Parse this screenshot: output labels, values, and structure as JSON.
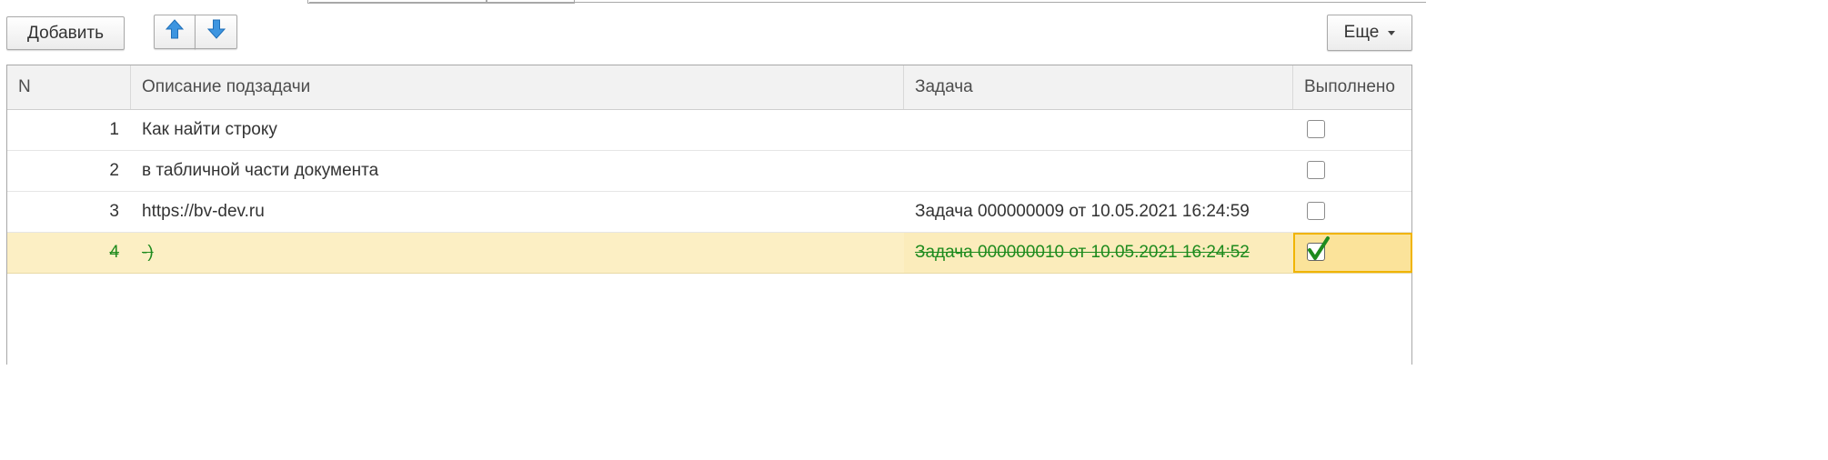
{
  "toolbar": {
    "add_label": "Добавить",
    "more_label": "Еще"
  },
  "table": {
    "columns": [
      "N",
      "Описание подзадачи",
      "Задача",
      "Выполнено"
    ],
    "rows": [
      {
        "n": "1",
        "description": "Как найти строку",
        "task": "",
        "done": false
      },
      {
        "n": "2",
        "description": "в табличной части документа",
        "task": "",
        "done": false
      },
      {
        "n": "3",
        "description": "https://bv-dev.ru",
        "task": "Задача 000000009 от 10.05.2021 16:24:59",
        "done": false
      },
      {
        "n": "4",
        "description": "-)",
        "task": "Задача 000000010 от 10.05.2021 16:24:52",
        "done": true
      }
    ]
  },
  "colors": {
    "selected_row_bg": "#fcefc4",
    "done_text": "#1e8b1e",
    "focus_border": "#f0b400",
    "arrow_blue": "#2f8ad8"
  },
  "icons": {
    "move_up": "arrow-up-icon",
    "move_down": "arrow-down-icon",
    "more_dropdown": "chevron-down-icon",
    "checkmark": "checkmark-icon"
  }
}
